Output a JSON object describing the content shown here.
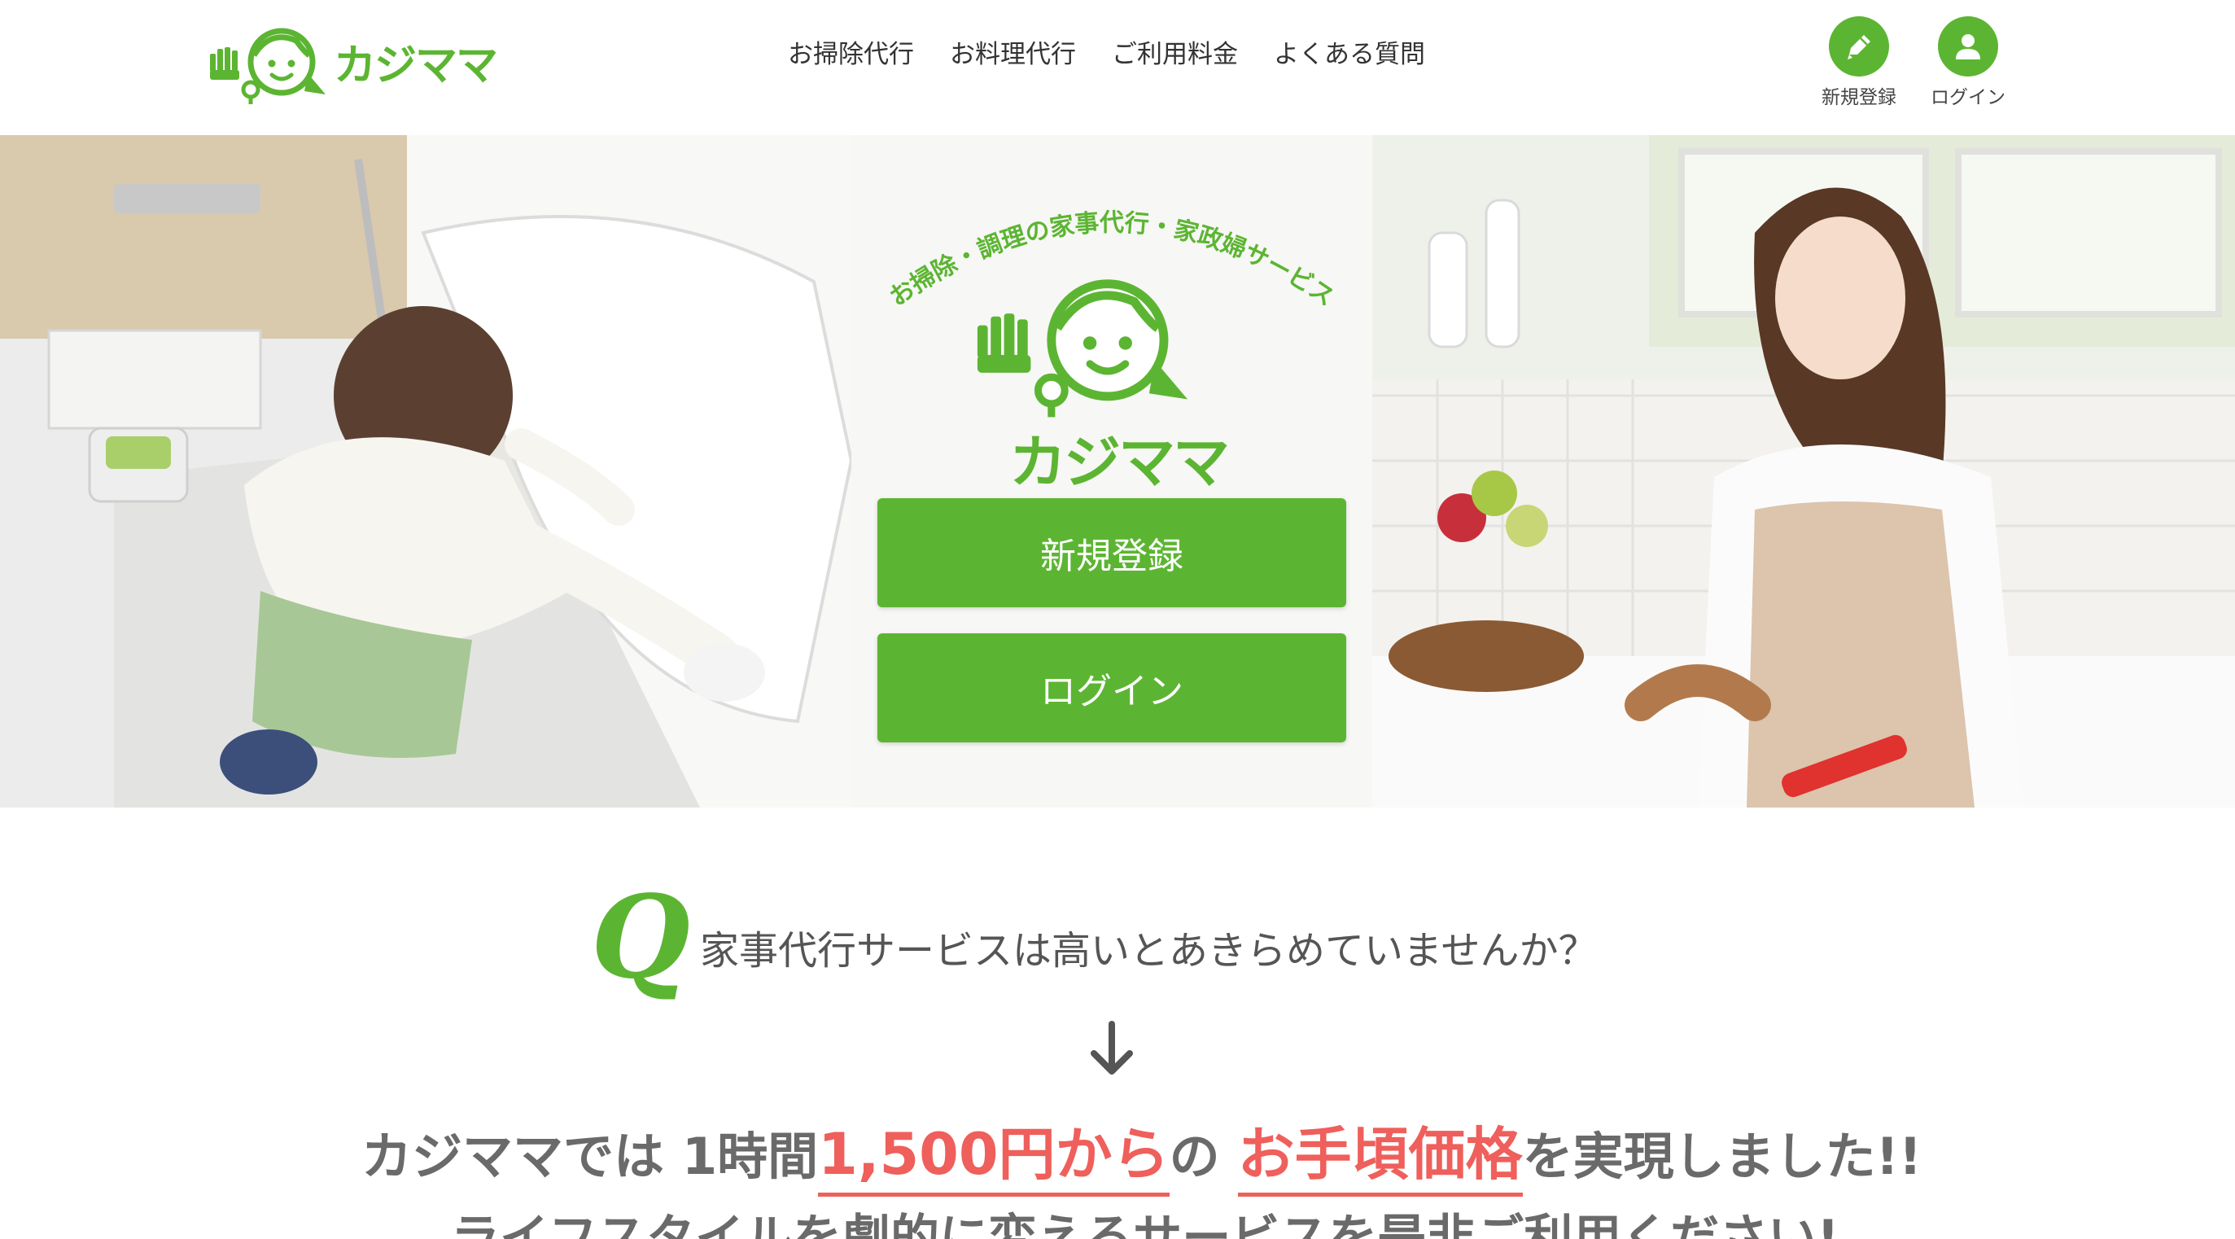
{
  "brand": {
    "name": "カジママ",
    "color": "#5cb532",
    "accent": "#ef5f5b"
  },
  "nav": {
    "items": [
      "お掃除代行",
      "お料理代行",
      "ご利用料金",
      "よくある質問"
    ]
  },
  "header_actions": {
    "signup": {
      "label": "新規登録",
      "icon": "pencil-icon"
    },
    "login": {
      "label": "ログイン",
      "icon": "user-icon"
    }
  },
  "hero": {
    "tagline": "お掃除・調理の家事代行・家政婦サービス",
    "logo_text": "カジママ",
    "signup_button": "新規登録",
    "login_button": "ログイン"
  },
  "intro": {
    "q_mark": "Q",
    "question": "家事代行サービスは高いとあきらめていませんか？",
    "headline_1": "カジママでは",
    "headline_2": "1時間",
    "headline_price": "1,500円から",
    "headline_3": "の",
    "headline_value": "お手頃価格",
    "headline_4": "を実現しました!!",
    "subline": "ライフスタイルを劇的に変えるサービスを是非ご利用ください!"
  }
}
